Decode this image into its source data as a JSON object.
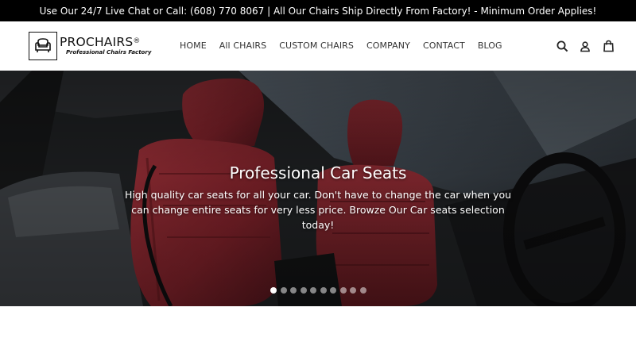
{
  "announcement": {
    "text": "Use Our 24/7 Live Chat or Call: (608) 770 8067 | All Our Chairs Ship Directly From Factory! - Minimum Order Applies!"
  },
  "brand": {
    "name": "PROCHAIRS",
    "registered": "®",
    "tagline": "Professional Chairs Factory",
    "logo_icon": "armchair-icon"
  },
  "nav": {
    "items": [
      {
        "label": "HOME"
      },
      {
        "label": "All CHAIRS"
      },
      {
        "label": "CUSTOM CHAIRS"
      },
      {
        "label": "COMPANY"
      },
      {
        "label": "CONTACT"
      },
      {
        "label": "BLOG"
      }
    ]
  },
  "header_icons": [
    "search-icon",
    "user-icon",
    "cart-icon"
  ],
  "hero": {
    "title": "Professional Car Seats",
    "subtitle": "High quality car seats for all your car. Don't have to change the car when you can change entire seats for very less price. Browze Our Car seats selection today!",
    "slide_count": 10,
    "active_slide": 1
  },
  "colors": {
    "announcement_bg": "#000000",
    "seat_leather": "#8a2a30",
    "active_dot": "#ffffff"
  }
}
